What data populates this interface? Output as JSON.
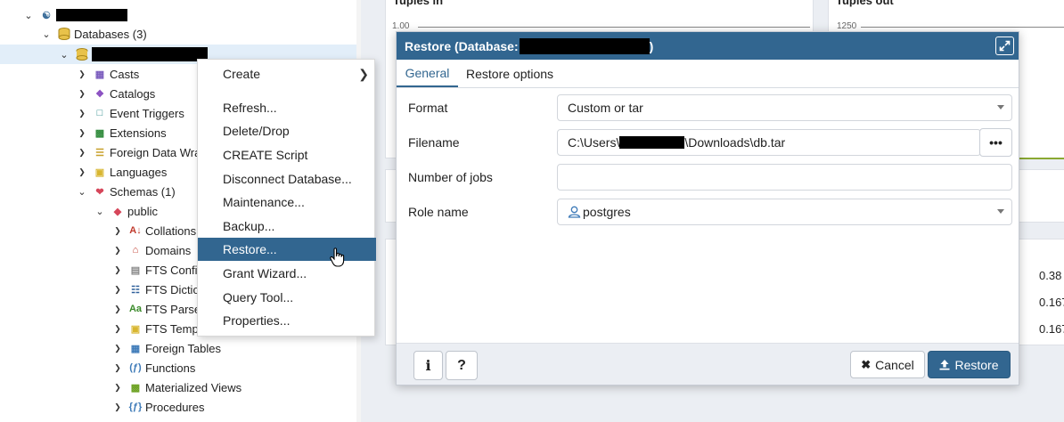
{
  "tree": {
    "databases_label": "Databases (3)",
    "items": [
      {
        "label": "Casts",
        "icon": "casts-icon"
      },
      {
        "label": "Catalogs",
        "icon": "catalogs-icon"
      },
      {
        "label": "Event Triggers",
        "icon": "event-triggers-icon"
      },
      {
        "label": "Extensions",
        "icon": "extensions-icon"
      },
      {
        "label": "Foreign Data Wra",
        "icon": "foreign-data-wrapper-icon"
      },
      {
        "label": "Languages",
        "icon": "languages-icon"
      },
      {
        "label": "Schemas (1)",
        "icon": "schemas-icon"
      },
      {
        "label": "public",
        "icon": "schema-public-icon"
      },
      {
        "label": "Collations",
        "icon": "collations-icon"
      },
      {
        "label": "Domains",
        "icon": "domains-icon"
      },
      {
        "label": "FTS Confi",
        "icon": "fts-config-icon"
      },
      {
        "label": "FTS Dictio",
        "icon": "fts-dictionary-icon"
      },
      {
        "label": "FTS Parse",
        "icon": "fts-parser-icon"
      },
      {
        "label": "FTS Temp",
        "icon": "fts-template-icon"
      },
      {
        "label": "Foreign Tables",
        "icon": "foreign-tables-icon"
      },
      {
        "label": "Functions",
        "icon": "functions-icon"
      },
      {
        "label": "Materialized Views",
        "icon": "materialized-views-icon"
      },
      {
        "label": "Procedures",
        "icon": "procedures-icon"
      }
    ]
  },
  "dashboard": {
    "tuples_in_title": "Tuples in",
    "tuples_out_title": "Tuples out",
    "tuples_in_axis": "1.00",
    "tuples_out_axis": "1250",
    "values": [
      "0.38",
      "0.167",
      "0.167"
    ]
  },
  "context_menu": {
    "items": [
      "Create",
      "Refresh...",
      "Delete/Drop",
      "CREATE Script",
      "Disconnect Database...",
      "Maintenance...",
      "Backup...",
      "Restore...",
      "Grant Wizard...",
      "Query Tool...",
      "Properties..."
    ],
    "selected": "Restore..."
  },
  "dialog": {
    "title_prefix": "Restore (Database:",
    "title_suffix": ")",
    "tabs": [
      "General",
      "Restore options"
    ],
    "format_label": "Format",
    "format_value": "Custom or tar",
    "filename_label": "Filename",
    "filename_prefix": "C:\\Users\\",
    "filename_suffix": "\\Downloads\\db.tar",
    "jobs_label": "Number of jobs",
    "jobs_value": "",
    "role_label": "Role name",
    "role_value": "postgres",
    "info_label": "i",
    "help_label": "?",
    "cancel_label": "Cancel",
    "restore_label": "Restore"
  },
  "colors": {
    "accent": "#326690",
    "selection": "#e2eef9"
  }
}
